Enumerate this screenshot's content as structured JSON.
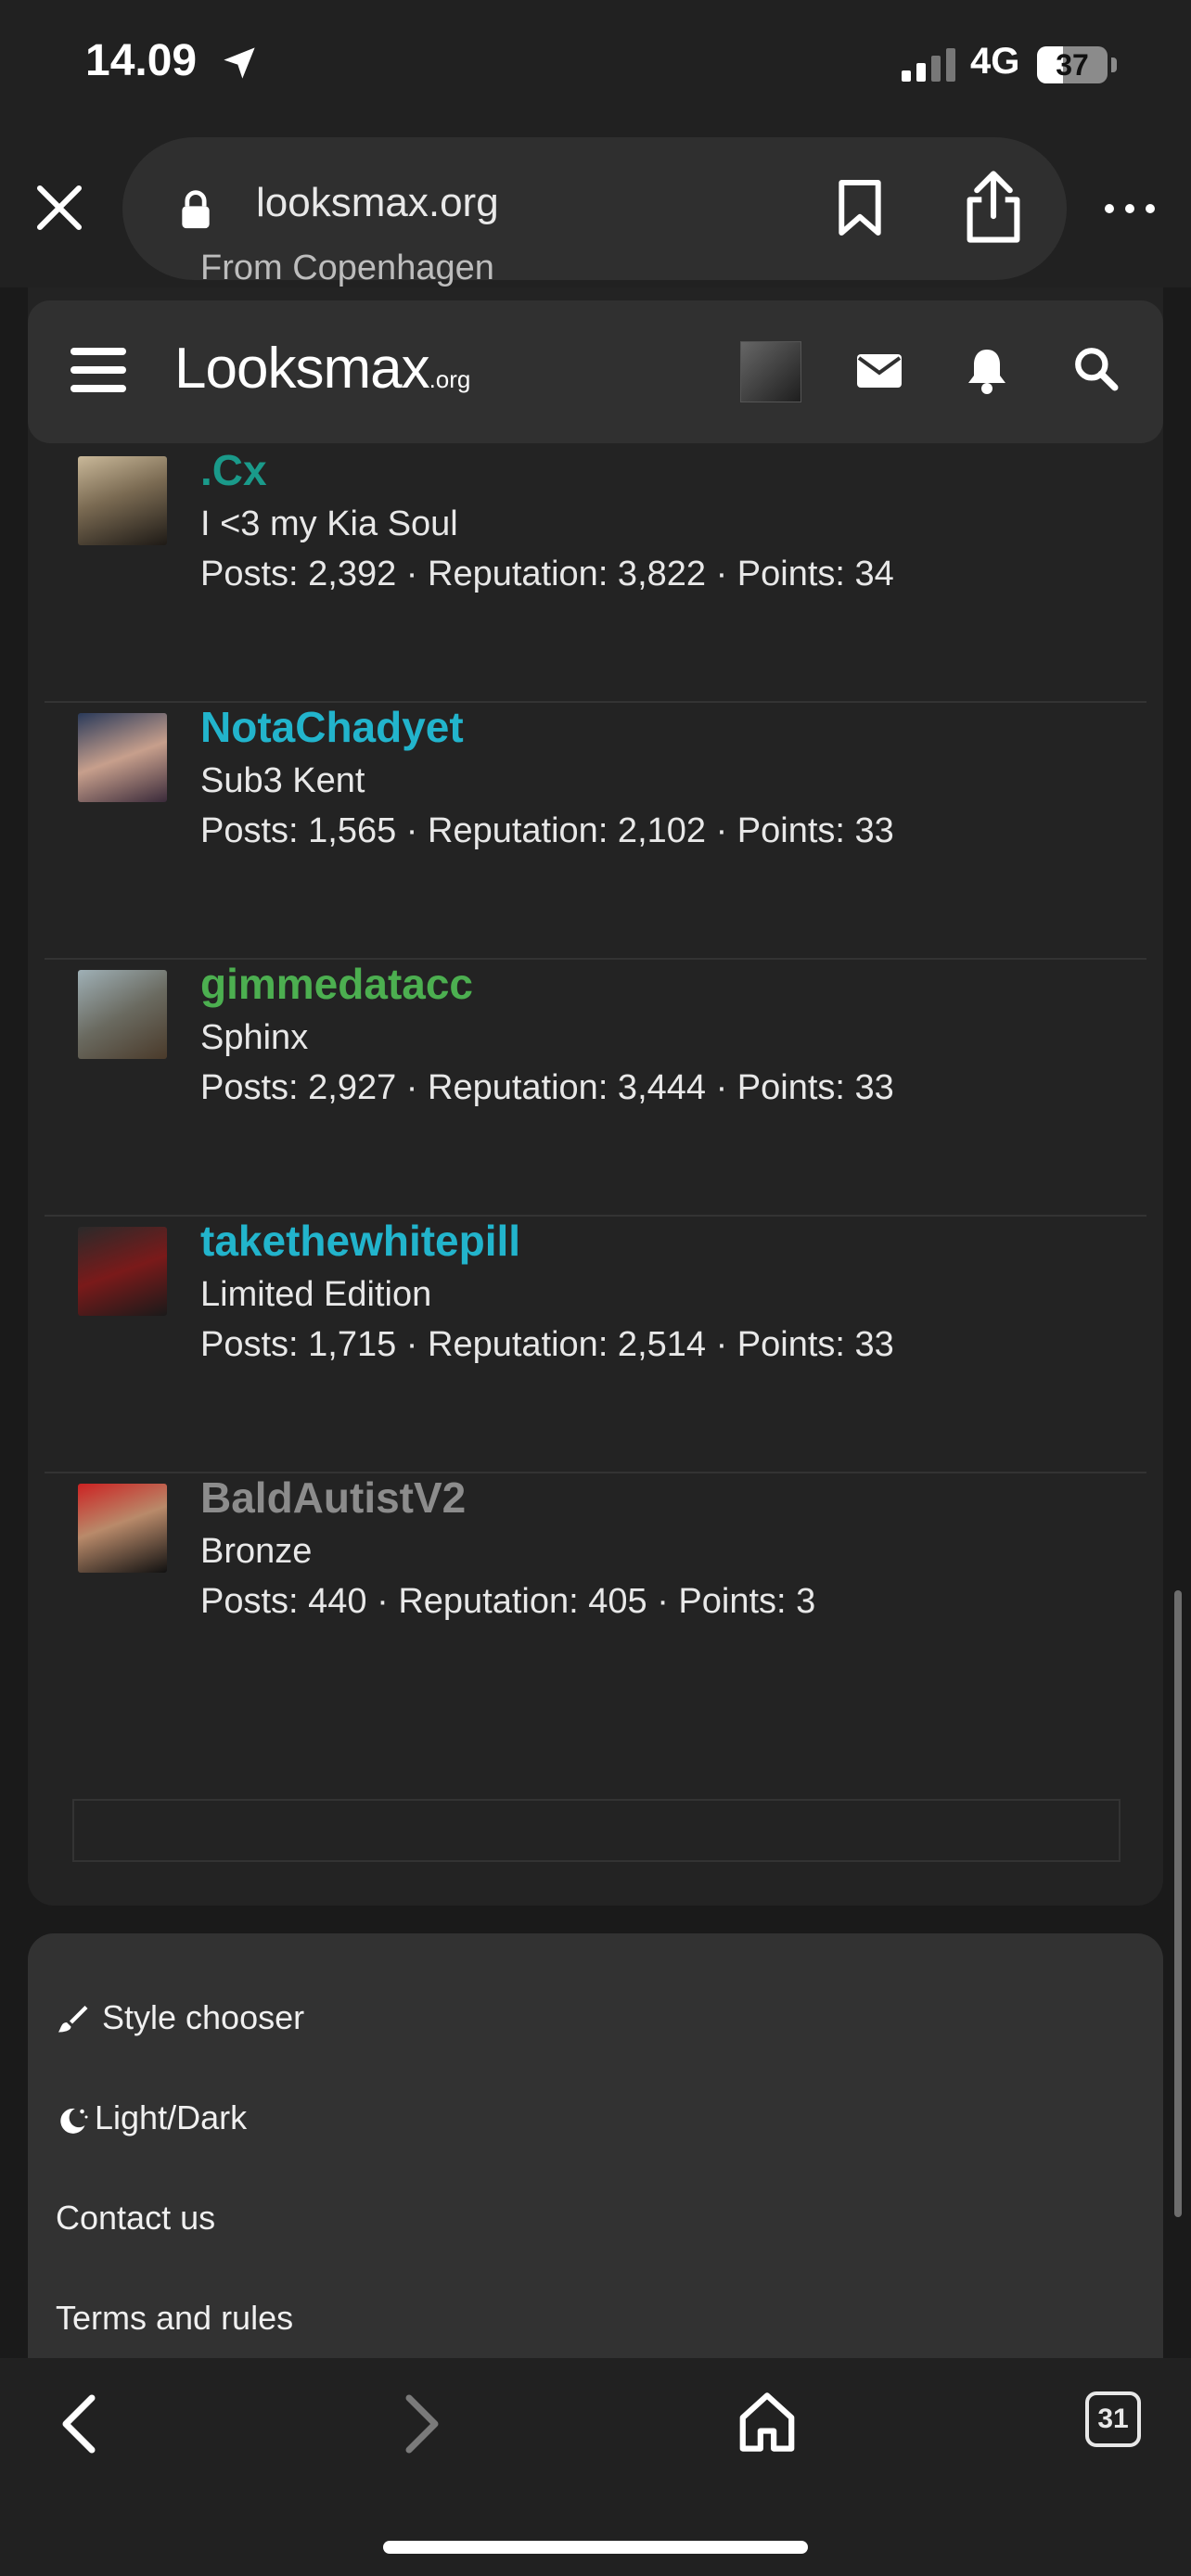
{
  "status_bar": {
    "time": "14.09",
    "network": "4G",
    "battery": "37"
  },
  "browser": {
    "url": "looksmax.org"
  },
  "peek_text": "From Copenhagen",
  "navbar": {
    "logo_main": "Looksmax",
    "logo_suffix": ".org"
  },
  "members": [
    {
      "name": ".Cx",
      "name_color": "#1a9a8a",
      "title": "I <3 my Kia Soul",
      "stats": "Posts: 2,392 · Reputation: 3,822 · Points: 34"
    },
    {
      "name": "NotaChadyet",
      "name_color": "#22b4cc",
      "title": "Sub3 Kent",
      "stats": "Posts: 1,565 · Reputation: 2,102 · Points: 33"
    },
    {
      "name": "gimmedatacc",
      "name_color": "#4caf50",
      "title": "Sphinx",
      "stats": "Posts: 2,927 · Reputation: 3,444 · Points: 33"
    },
    {
      "name": "takethewhitepill",
      "name_color": "#22b4cc",
      "title": "Limited Edition",
      "stats": "Posts: 1,715 · Reputation: 2,514 · Points: 33"
    },
    {
      "name": "BaldAutistV2",
      "name_color": "#8c8c8c",
      "title": "Bronze",
      "stats": "Posts: 440 · Reputation: 405 · Points: 3"
    }
  ],
  "footer": {
    "style_chooser": "Style chooser",
    "light_dark": "Light/Dark",
    "contact_us": "Contact us",
    "terms": "Terms and rules"
  },
  "toolbar": {
    "tab_count": "31"
  },
  "colors": {
    "background": "#1a1a1a",
    "card": "#232323",
    "navbar": "#303030",
    "footer": "#323232"
  }
}
